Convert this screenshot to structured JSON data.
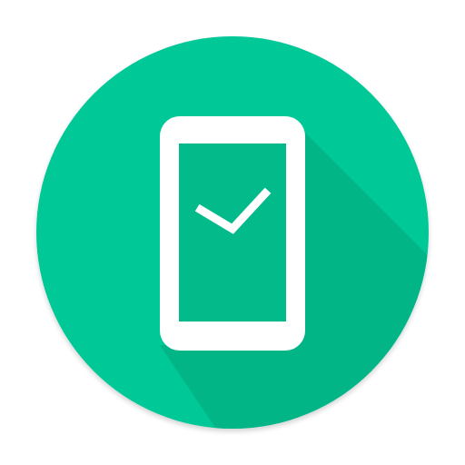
{
  "icon": {
    "name": "phone-check-icon",
    "colors": {
      "circle": "#03C896",
      "long_shadow": "#02B587",
      "phone_body": "#FFFFFF",
      "screen": "#03BA8A",
      "check": "#FFFFFF",
      "background": "#FFFFFF"
    }
  }
}
